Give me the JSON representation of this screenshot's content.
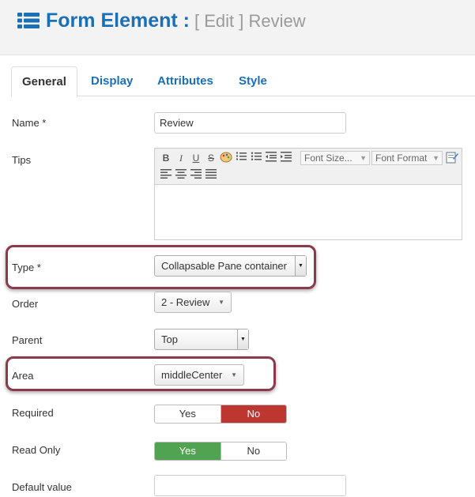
{
  "header": {
    "icon": "list-icon",
    "title": "Form Element :",
    "subtitle": "[ Edit ] Review"
  },
  "tabs": [
    {
      "label": "General",
      "active": true
    },
    {
      "label": "Display",
      "active": false
    },
    {
      "label": "Attributes",
      "active": false
    },
    {
      "label": "Style",
      "active": false
    }
  ],
  "fields": {
    "name": {
      "label": "Name *",
      "value": "Review"
    },
    "tips": {
      "label": "Tips",
      "toolbar": {
        "bold": "B",
        "italic": "I",
        "underline": "U",
        "strike": "S",
        "font_size_placeholder": "Font Size...",
        "font_format_placeholder": "Font Format"
      }
    },
    "type": {
      "label": "Type *",
      "value": "Collapsable Pane container"
    },
    "order": {
      "label": "Order",
      "value": "2 - Review"
    },
    "parent": {
      "label": "Parent",
      "value": "Top"
    },
    "area": {
      "label": "Area",
      "value": "middleCenter"
    },
    "required": {
      "label": "Required",
      "yes": "Yes",
      "no": "No",
      "selected": "No"
    },
    "read_only": {
      "label": "Read Only",
      "yes": "Yes",
      "no": "No",
      "selected": "Yes"
    },
    "default_value": {
      "label": "Default value",
      "value": ""
    }
  },
  "colors": {
    "accent": "#1a6fb5",
    "highlight": "#8b3a4e",
    "toggle_no": "#bd362f",
    "toggle_yes": "#51a351"
  }
}
